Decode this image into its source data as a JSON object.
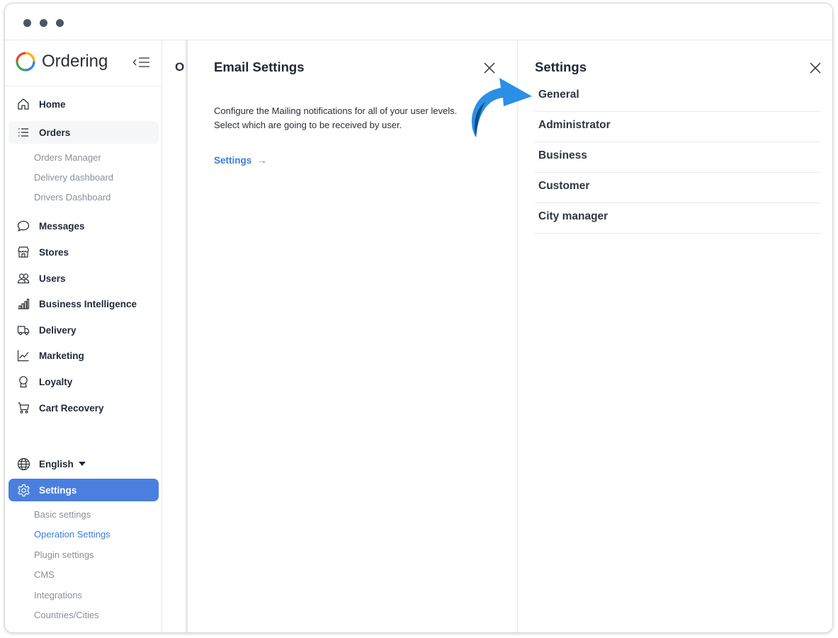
{
  "brand": {
    "name": "Ordering"
  },
  "sidebar": {
    "items": [
      {
        "id": "home",
        "label": "Home",
        "icon": "home-icon"
      },
      {
        "id": "orders",
        "label": "Orders",
        "icon": "list-icon"
      },
      {
        "id": "messages",
        "label": "Messages",
        "icon": "chat-bubble-icon"
      },
      {
        "id": "stores",
        "label": "Stores",
        "icon": "store-icon"
      },
      {
        "id": "users",
        "label": "Users",
        "icon": "users-icon"
      },
      {
        "id": "business-intelligence",
        "label": "Business Intelligence",
        "icon": "bar-chart-icon"
      },
      {
        "id": "delivery",
        "label": "Delivery",
        "icon": "truck-icon"
      },
      {
        "id": "marketing",
        "label": "Marketing",
        "icon": "line-chart-icon"
      },
      {
        "id": "loyalty",
        "label": "Loyalty",
        "icon": "award-icon"
      },
      {
        "id": "cart-recovery",
        "label": "Cart Recovery",
        "icon": "cart-icon"
      }
    ],
    "orders_sub": [
      "Orders Manager",
      "Delivery dashboard",
      "Drivers Dashboard"
    ],
    "language": {
      "label": "English",
      "icon": "globe-icon"
    },
    "settings": {
      "label": "Settings",
      "icon": "gear-icon"
    },
    "settings_sub": [
      "Basic settings",
      "Operation Settings",
      "Plugin settings",
      "CMS",
      "Integrations",
      "Countries/Cities"
    ],
    "settings_active_sub": "Operation Settings"
  },
  "background_page": {
    "title_fragment": "O"
  },
  "email_panel": {
    "title": "Email Settings",
    "description_line1": "Configure the Mailing notifications for all of your user levels.",
    "description_line2": "Select which are going to be received by user.",
    "link_label": "Settings",
    "link_arrow": "→"
  },
  "settings_panel": {
    "title": "Settings",
    "roles": [
      "General",
      "Administrator",
      "Business",
      "Customer",
      "City manager"
    ]
  },
  "colors": {
    "accent": "#3b7ddd",
    "active_nav_bg": "#4a7fe0",
    "annotation_arrow": "#2b8fe6"
  }
}
